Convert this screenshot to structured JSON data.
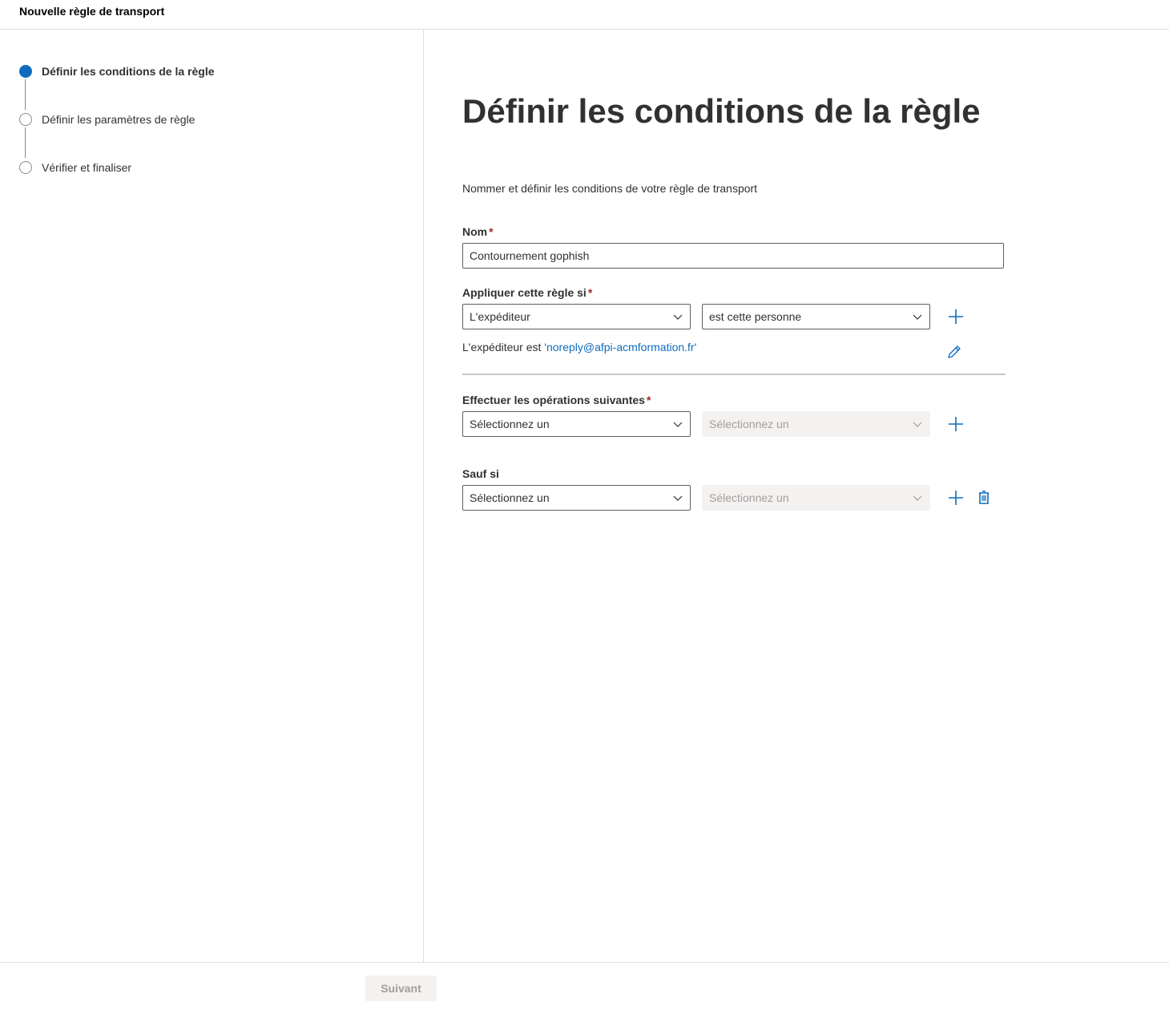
{
  "header": {
    "title": "Nouvelle règle de transport"
  },
  "steps": [
    {
      "label": "Définir les conditions de la règle",
      "active": true
    },
    {
      "label": "Définir les paramètres de règle",
      "active": false
    },
    {
      "label": "Vérifier et finaliser",
      "active": false
    }
  ],
  "main": {
    "heading": "Définir les conditions de la règle",
    "subtitle": "Nommer et définir les conditions de votre règle de transport",
    "name_label": "Nom",
    "name_value": "Contournement gophish",
    "apply_label": "Appliquer cette règle si",
    "apply_condition_1": "L'expéditeur",
    "apply_condition_2": "est cette personne",
    "apply_summary_prefix": "L'expéditeur est ",
    "apply_summary_value": "'noreply@afpi-acmformation.fr'",
    "actions_label": "Effectuer les opérations suivantes",
    "actions_select_1": "Sélectionnez un",
    "actions_select_2": "Sélectionnez un",
    "except_label": "Sauf si",
    "except_select_1": "Sélectionnez un",
    "except_select_2": "Sélectionnez un",
    "required_mark": "*"
  },
  "footer": {
    "next_label": "Suivant"
  },
  "colors": {
    "accent": "#0f6cbd",
    "required": "#a4262c",
    "disabled_bg": "#f3f2f1"
  }
}
